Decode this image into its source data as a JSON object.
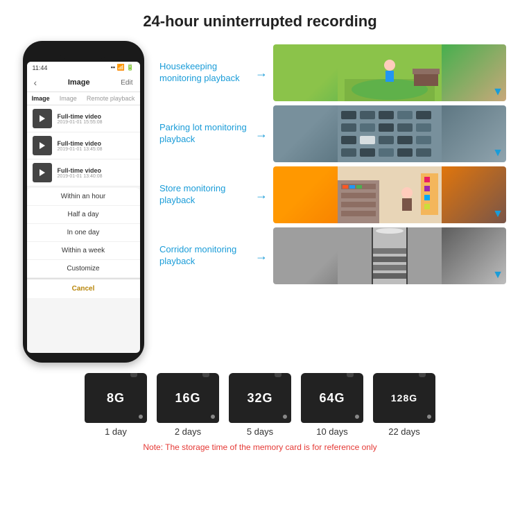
{
  "header": {
    "title": "24-hour uninterrupted recording"
  },
  "phone": {
    "time": "11:44",
    "nav": {
      "back": "‹",
      "title": "Image",
      "edit": "Edit"
    },
    "tabs": [
      "Image",
      "Image",
      "Remote playback"
    ],
    "videos": [
      {
        "title": "Full-time video",
        "date": "2019-01-01 15:55:08"
      },
      {
        "title": "Full-time video",
        "date": "2019-01-01 13:45:08"
      },
      {
        "title": "Full-time video",
        "date": "2019-01-01 13:40:08"
      }
    ],
    "dropdown": {
      "items": [
        "Within an hour",
        "Half a day",
        "In one day",
        "Within a week",
        "Customize"
      ],
      "cancel": "Cancel"
    }
  },
  "monitoring": {
    "items": [
      {
        "label": "Housekeeping monitoring playback",
        "imgClass": "img-housekeeping"
      },
      {
        "label": "Parking lot monitoring playback",
        "imgClass": "img-parking"
      },
      {
        "label": "Store monitoring playback",
        "imgClass": "img-store"
      },
      {
        "label": "Corridor monitoring playback",
        "imgClass": "img-corridor"
      }
    ]
  },
  "storage": {
    "cards": [
      {
        "size": "8G",
        "days": "1 day"
      },
      {
        "size": "16G",
        "days": "2 days"
      },
      {
        "size": "32G",
        "days": "5 days"
      },
      {
        "size": "64G",
        "days": "10 days"
      },
      {
        "size": "128G",
        "days": "22 days"
      }
    ],
    "note": "Note: The storage time of the memory card is for reference only"
  }
}
